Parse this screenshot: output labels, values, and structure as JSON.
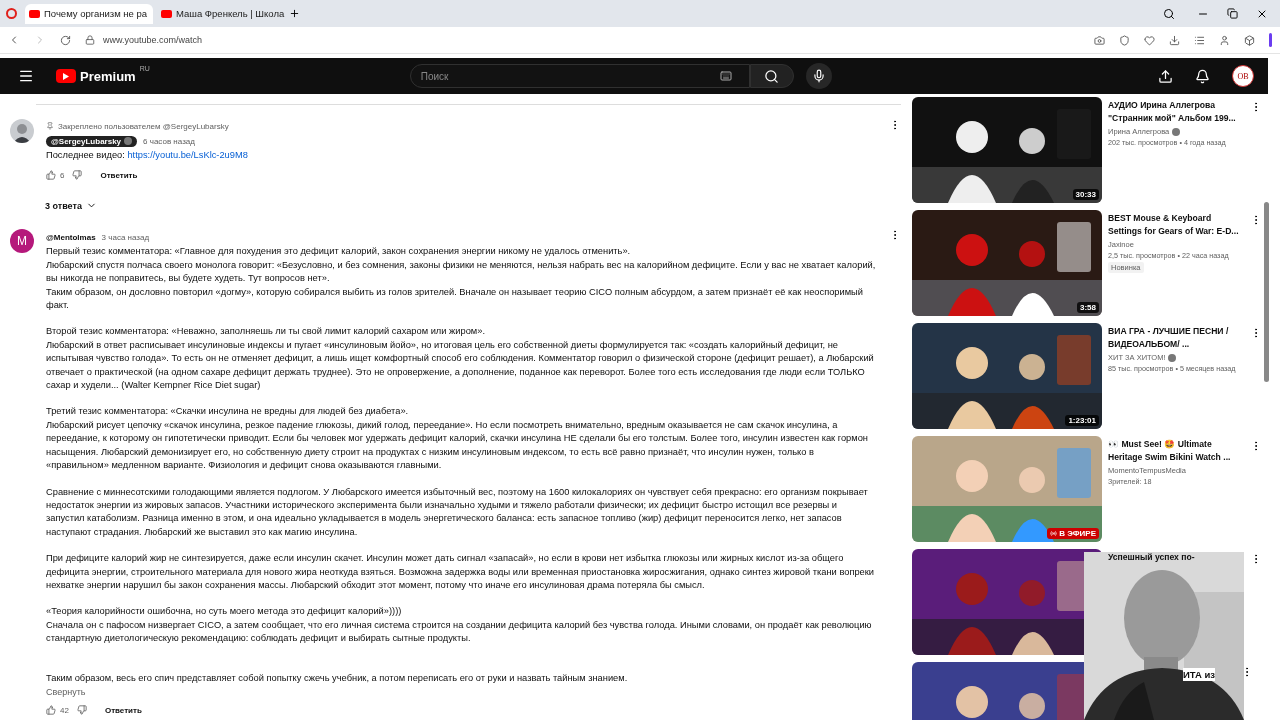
{
  "browser": {
    "tabs": [
      {
        "title": "Почему организм не ра",
        "selected": true
      },
      {
        "title": "Маша Френкель | Школа",
        "selected": false
      }
    ],
    "url": "www.youtube.com/watch"
  },
  "header": {
    "logo": "Premium",
    "region": "RU",
    "search_placeholder": "Поиск",
    "avatar": "ОВ"
  },
  "comments": [
    {
      "kind": "pinned",
      "pinned_label": "Закреплено пользователем @SergeyLubarsky",
      "author": "@SergeyLubarsky",
      "time": "6 часов назад",
      "text": "Последнее видео: ",
      "link": "https://youtu.be/LsKlc-2u9M8",
      "likes": "6",
      "reply": "Ответить",
      "replies": "3 ответа"
    },
    {
      "kind": "regular",
      "avatar": "M",
      "author": "@Mentolmas",
      "time": "3 часа назад",
      "paragraphs": [
        "Первый тезис комментатора: «Главное для похудения это дефицит калорий, закон сохранения энергии никому не удалось отменить».\nЛюбарский спустя полчаса своего монолога говорит: «Безусловно, и без сомнения, законы физики не меняются, нельзя набрать вес на калорийном дефиците. Если у вас не хватает калорий, вы никогда не поправитесь, вы будете худеть. Тут вопросов нет».\nТаким образом, он дословно повторил «догму», которую собирался выбить из голов зрителей. Вначале он называет теорию CICO полным абсурдом, а затем признаёт её как неоспоримый факт.",
        "Второй тезис комментатора: «Неважно, заполняешь ли ты свой лимит калорий сахаром или жиром».\nЛюбарский в ответ расписывает инсулиновые индексы и пугает «инсулиновым йойо», но итоговая цель его собственной диеты формулируется так: «создать калорийный дефицит, не испытывая чувство голода». То есть он не отменяет дефицит, а лишь ищет комфортный способ его соблюдения. Комментатор говорил о физической стороне (дефицит решает), а Любарский отвечает о практической (на одном сахаре дефицит держать труднее). Это не опровержение, а дополнение, поданное как переворот. Более того есть исследования где люди если ТОЛЬКО сахар и худели... (Walter Kempner Rice Diet sugar)",
        "Третий тезис комментатора: «Скачки инсулина не вредны для людей без диабета».\nЛюбарский рисует цепочку «скачок инсулина, резкое падение глюкозы, дикий голод, переедание». Но если посмотреть внимательно, вредным оказывается не сам скачок инсулина, а переедание, к которому он гипотетически приводит. Если бы человек мог удержать дефицит калорий, скачки инсулина НЕ сделали бы его толстым. Более того, инсулин известен как гормон насыщения. Любарский демонизирует его, но собственную диету строит на продуктах с низким инсулиновым индексом, то есть всё равно признаёт, что инсулин нужен, только в «правильном» медленном варианте. Физиология и дефицит снова оказываются главными.",
        "Сравнение с миннесотскими голодающими является подлогом. У Любарского имеется избыточный вес, поэтому на 1600 килокалориях он чувствует себя прекрасно: его организм покрывает недостаток энергии из жировых запасов. Участники исторического эксперимента были изначально худыми и тяжело работали физически; их дефицит быстро истощил все резервы и запустил катаболизм. Разница именно в этом, и она идеально укладывается в модель энергетического баланса: есть запасное топливо (жир) дефицит переносится легко, нет запасов наступают страдания. Любарский же выставил это как магию инсулина.",
        "При дефиците калорий жир не синтезируется, даже если инсулин скачет. Инсулин может дать сигнал «запасай», но если в крови нет избытка глюкозы или жирных кислот из-за общего дефицита энергии, строительного материала для нового жира неоткуда взяться. Возможна задержка воды или временная приостановка жиросжигания, однако синтез жировой ткани вопреки нехватке энергии нарушил бы закон сохранения массы. Любарский обходит этот момент, потому что иначе его инсулиновая драма потеряла бы смысл.",
        "«Теория калорийности ошибочна, но суть моего метода это дефицит калорий»))))\nСначала он с пафосом низвергает CICO, а затем сообщает, что его личная система строится на создании дефицита калорий без чувства голода. Иными словами, он продаёт как революцию стандартную диетологическую рекомендацию: соблюдать дефицит и выбирать сытные продукты.",
        "\nТаким образом, весь его спич представляет собой попытку сжечь учебник, а потом переписать его от руки и назвать тайным знанием."
      ],
      "collapse": "Свернуть",
      "likes": "42",
      "reply": "Ответить"
    }
  ],
  "videos": [
    {
      "kind": "full",
      "title": "АУДИО Ирина Аллегрова \"Странник мой\" Альбом 199...",
      "channel": "Ирина Аллегрова",
      "verified": true,
      "meta": "202 тыс. просмотров • 4 года назад",
      "duration": "30:33"
    },
    {
      "kind": "full",
      "title": "BEST Mouse & Keyboard Settings for Gears of War: E-D...",
      "channel": "Jaxinoe",
      "verified": false,
      "meta": "2,5 тыс. просмотров • 22 часа назад",
      "badge": "Новинка",
      "duration": "3:58"
    },
    {
      "kind": "full",
      "title": "ВИА ГРА - ЛУЧШИЕ ПЕСНИ / ВИДЕОАЛЬБОМ/ ...",
      "channel": "ХИТ ЗА ХИТОМ!",
      "verified": true,
      "meta": "85 тыс. просмотров • 5 месяцев назад",
      "duration": "1:23:01"
    },
    {
      "kind": "full",
      "title": "👀 Must See! 🤩 Ultimate Heritage Swim Bikini Watch ...",
      "channel": "MomentoTempusMedia",
      "verified": false,
      "meta": "Зрителей: 18",
      "live": "В ЭФИРЕ"
    },
    {
      "kind": "full",
      "title": "Успешный успех по-"
    },
    {
      "kind": "partial",
      "title": "ИТА из"
    }
  ]
}
